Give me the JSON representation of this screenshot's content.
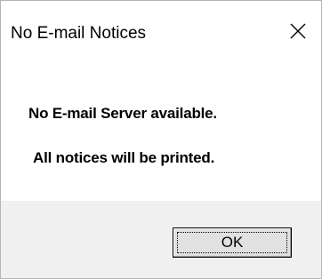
{
  "window": {
    "title": "No E-mail Notices",
    "close_icon": "close-icon"
  },
  "message": {
    "line1": "No E-mail Server available.",
    "line2": "All notices will be printed."
  },
  "buttons": {
    "ok_label": "OK"
  }
}
